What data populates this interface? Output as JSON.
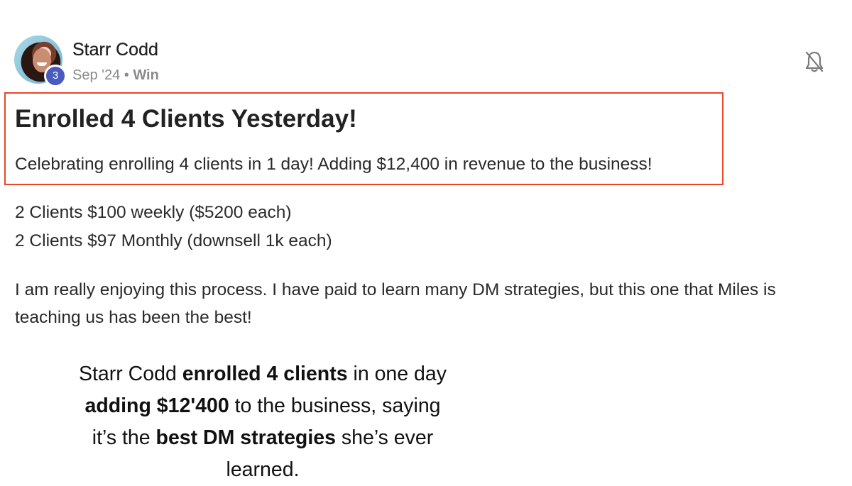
{
  "post": {
    "author": {
      "name": "Starr Codd",
      "level": "3"
    },
    "date": "Sep '24",
    "separator": "•",
    "category": "Win",
    "title": "Enrolled 4 Clients Yesterday!",
    "summary": "Celebrating enrolling 4 clients in 1 day! Adding $12,400 in revenue to the business!",
    "lines": [
      "2 Clients $100 weekly ($5200 each)",
      "2 Clients $97 Monthly (downsell 1k each)",
      "I am really enjoying this process. I have paid to learn many DM strategies, but this one that Miles is",
      "teaching us has been the best!"
    ]
  },
  "caption": {
    "p1": "Starr Codd ",
    "b1": "enrolled 4 clients",
    "p2": " in one day ",
    "b2": "adding $12'400",
    "p3": " to the business, saying it’s the ",
    "b3": "best DM strategies",
    "p4": " she’s ever learned."
  },
  "icons": {
    "bell": "bell-off-icon"
  },
  "colors": {
    "highlight": "#e8472b",
    "badge": "#4a5bbf"
  }
}
